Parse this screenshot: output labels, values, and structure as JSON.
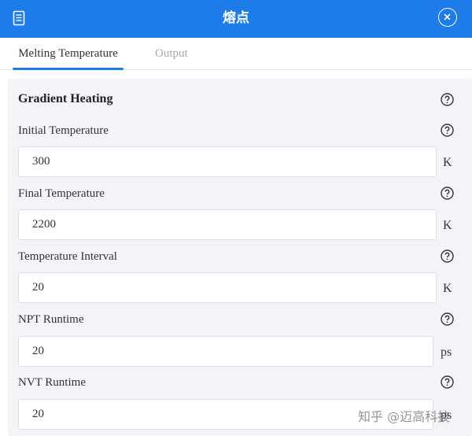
{
  "header": {
    "title": "熔点",
    "doc_icon": "document-icon",
    "close_icon": "close-icon",
    "color": "#1e7bea"
  },
  "tabs": [
    {
      "label": "Melting Temperature",
      "active": true
    },
    {
      "label": "Output",
      "active": false
    }
  ],
  "section": {
    "title": "Gradient Heating",
    "fields": [
      {
        "label": "Initial Temperature",
        "value": "300",
        "unit": "K"
      },
      {
        "label": "Final Temperature",
        "value": "2200",
        "unit": "K"
      },
      {
        "label": "Temperature Interval",
        "value": "20",
        "unit": "K"
      },
      {
        "label": "NPT Runtime",
        "value": "20",
        "unit": "ps"
      },
      {
        "label": "NVT Runtime",
        "value": "20",
        "unit": "ps"
      }
    ]
  },
  "watermark": "知乎 @迈高科技"
}
